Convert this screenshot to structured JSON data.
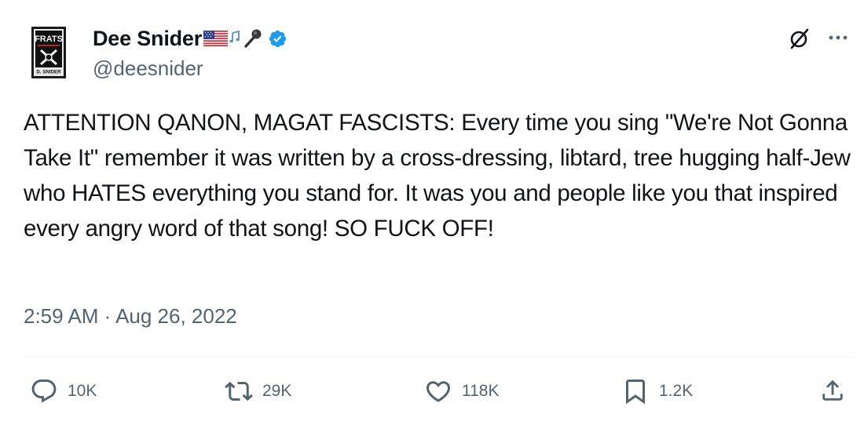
{
  "author": {
    "display_name": "Dee Snider",
    "handle": "@deesnider",
    "avatar_text_top": "FRATS",
    "avatar_text_bottom": "D. SNIDER"
  },
  "tweet": {
    "text": "ATTENTION QANON, MAGAT FASCISTS: Every time you sing \"We're Not Gonna Take It\" remember it was written by a cross-dressing, libtard, tree hugging half-Jew who HATES everything you stand for. It was you and people like you that inspired every angry word of that song! SO FUCK OFF!",
    "timestamp": "2:59 AM · Aug 26, 2022"
  },
  "actions": {
    "replies": "10K",
    "reposts": "29K",
    "likes": "118K",
    "bookmarks": "1.2K"
  },
  "colors": {
    "text": "#0f1419",
    "secondary": "#536471",
    "verified": "#1d9bf0",
    "divider": "#eff3f4"
  },
  "icons": [
    "verified-badge-icon",
    "grok-icon",
    "more-icon",
    "reply-icon",
    "repost-icon",
    "like-icon",
    "bookmark-icon",
    "share-icon",
    "us-flag-icon",
    "music-notes-icon",
    "microphone-icon"
  ]
}
